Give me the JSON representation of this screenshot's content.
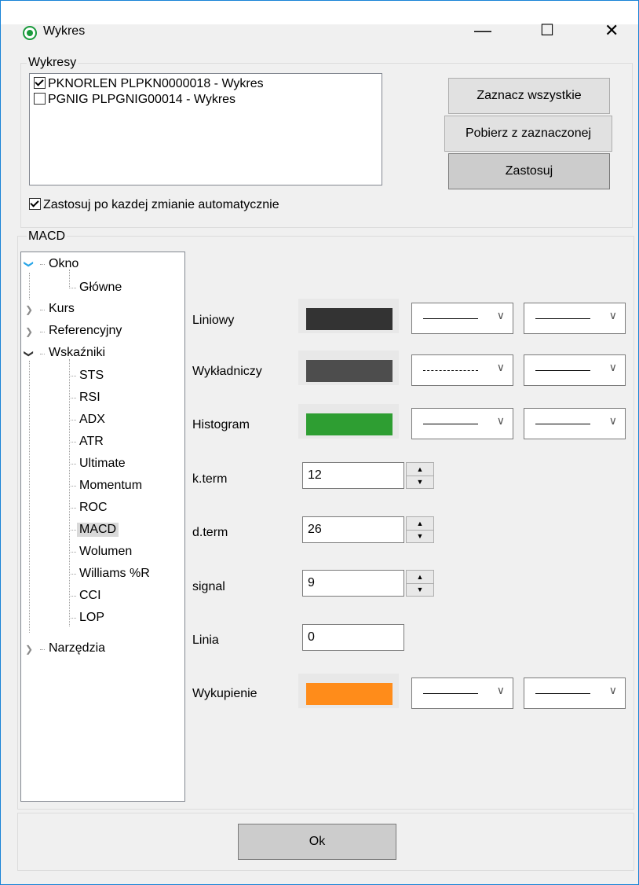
{
  "window": {
    "title": "Wykres",
    "minimize": "—",
    "maximize": "☐",
    "close": "✕"
  },
  "wykresy": {
    "legend": "Wykresy",
    "items": [
      {
        "label": "PKNORLEN PLPKN0000018 - Wykres",
        "checked": true
      },
      {
        "label": "PGNIG PLPGNIG00014 - Wykres",
        "checked": false
      }
    ],
    "auto_apply_label": "Zastosuj po kazdej zmianie automatycznie",
    "auto_apply_checked": true,
    "btn_select_all": "Zaznacz wszystkie",
    "btn_get_from_selected": "Pobierz z zaznaczonej",
    "btn_apply": "Zastosuj"
  },
  "macd": {
    "legend": "MACD",
    "tree": {
      "okno": "Okno",
      "glowne": "Główne",
      "kurs": "Kurs",
      "referencyjny": "Referencyjny",
      "wskazniki": "Wskaźniki",
      "children": [
        "STS",
        "RSI",
        "ADX",
        "ATR",
        "Ultimate",
        "Momentum",
        "ROC",
        "MACD",
        "Wolumen",
        "Williams %R",
        "CCI",
        "LOP"
      ],
      "narzedzia": "Narzędzia",
      "selected": "MACD"
    },
    "rows": {
      "liniowy": "Liniowy",
      "wykladniczy": "Wykładniczy",
      "histogram": "Histogram",
      "kterm": "k.term",
      "dterm": "d.term",
      "signal": "signal",
      "linia": "Linia",
      "wykupienie": "Wykupienie"
    },
    "values": {
      "kterm": "12",
      "dterm": "26",
      "signal": "9",
      "linia": "0"
    },
    "colors": {
      "liniowy": "#333333",
      "wykladniczy": "#4d4d4d",
      "histogram": "#2e9e32",
      "wykupienie": "#ff8c1a"
    }
  },
  "footer": {
    "ok": "Ok"
  }
}
